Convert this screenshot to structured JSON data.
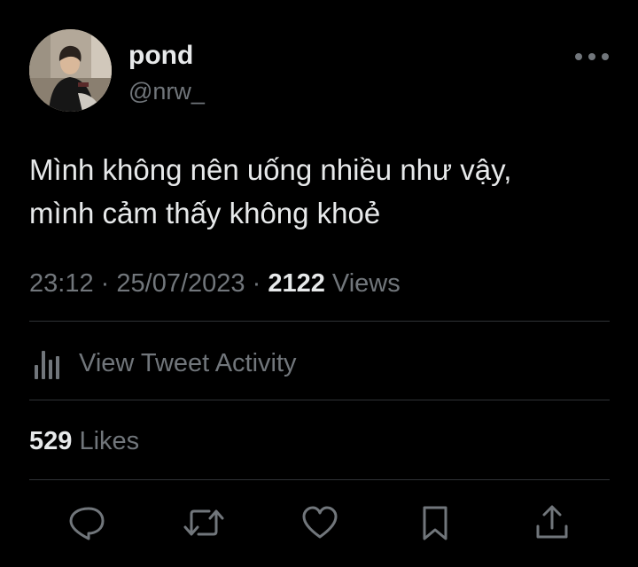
{
  "author": {
    "display_name": "pond",
    "handle": "@nrw_"
  },
  "tweet": {
    "text_lines": [
      "Mình không nên uống nhiều như vậy,",
      "mình cảm thấy không khoẻ"
    ],
    "time": "23:12",
    "date": "25/07/2023",
    "separator": "·",
    "views_count": "2122",
    "views_label": "Views"
  },
  "activity": {
    "label": "View Tweet Activity",
    "icon": "analytics-bars-icon"
  },
  "engagement": {
    "likes_count": "529",
    "likes_label": "Likes"
  },
  "actions": [
    {
      "name": "reply",
      "icon": "reply-icon"
    },
    {
      "name": "retweet",
      "icon": "retweet-icon"
    },
    {
      "name": "like",
      "icon": "heart-icon"
    },
    {
      "name": "bookmark",
      "icon": "bookmark-icon"
    },
    {
      "name": "share",
      "icon": "share-icon"
    }
  ],
  "colors": {
    "background": "#000000",
    "primary_text": "#e7e9ea",
    "secondary_text": "#71767b",
    "divider": "#2f3336"
  }
}
